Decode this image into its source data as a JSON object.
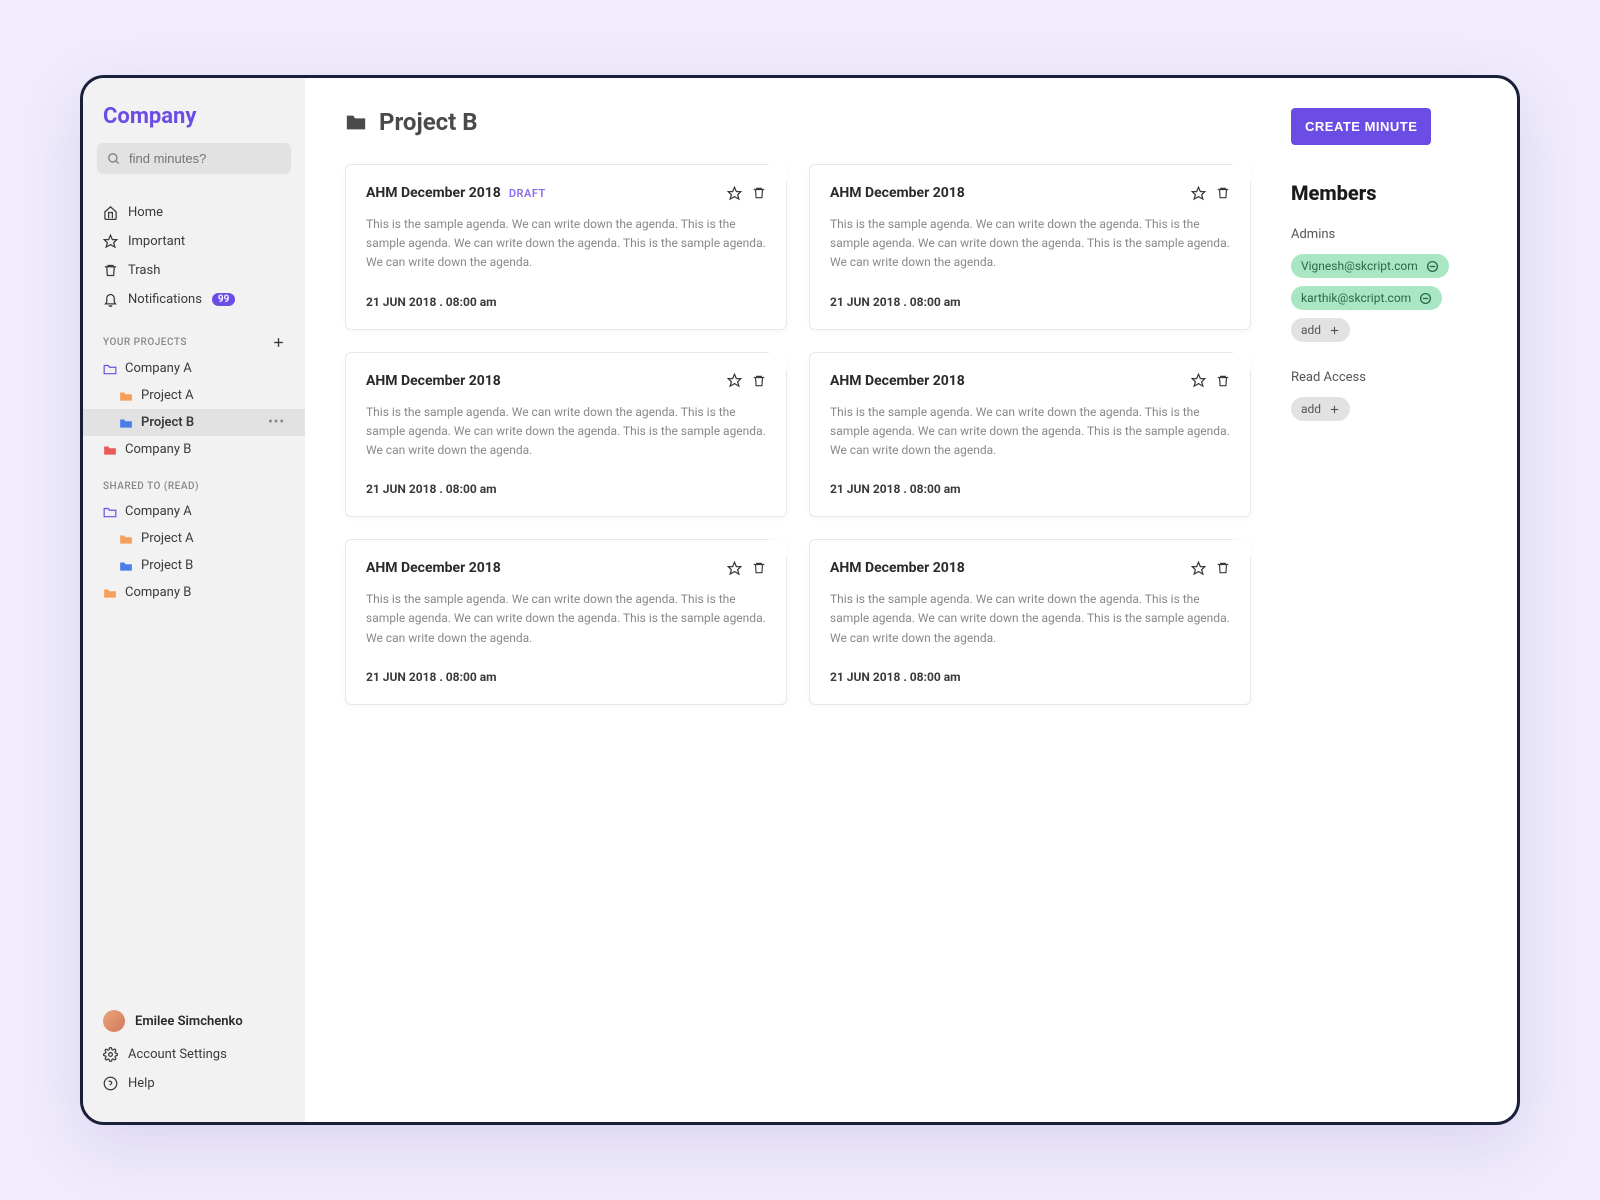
{
  "brand": "Company",
  "search": {
    "placeholder": "find minutes?"
  },
  "nav": {
    "home": "Home",
    "important": "Important",
    "trash": "Trash",
    "notifications": "Notifications",
    "notif_count": "99"
  },
  "sections": {
    "your_projects": "YOUR PROJECTS",
    "shared_read": "SHARED TO (READ)"
  },
  "tree": {
    "company_a": "Company A",
    "project_a": "Project A",
    "project_b": "Project B",
    "company_b": "Company B"
  },
  "user": {
    "name": "Emilee Simchenko",
    "account_settings": "Account Settings",
    "help": "Help"
  },
  "page": {
    "title": "Project B"
  },
  "cards": [
    {
      "title": "AHM December 2018",
      "draft": "DRAFT",
      "desc": "This is the sample agenda. We can write down the agenda. This is the sample agenda. We can write down the agenda. This is the sample agenda. We can write down the agenda.",
      "date": "21 JUN 2018 . 08:00 am"
    },
    {
      "title": "AHM December 2018",
      "draft": "",
      "desc": "This is the sample agenda. We can write down the agenda. This is the sample agenda. We can write down the agenda. This is the sample agenda. We can write down the agenda.",
      "date": "21 JUN 2018 . 08:00 am"
    },
    {
      "title": "AHM December 2018",
      "draft": "",
      "desc": "This is the sample agenda. We can write down the agenda. This is the sample agenda. We can write down the agenda. This is the sample agenda. We can write down the agenda.",
      "date": "21 JUN 2018 . 08:00 am"
    },
    {
      "title": "AHM December 2018",
      "draft": "",
      "desc": "This is the sample agenda. We can write down the agenda. This is the sample agenda. We can write down the agenda. This is the sample agenda. We can write down the agenda.",
      "date": "21 JUN 2018 . 08:00 am"
    },
    {
      "title": "AHM December 2018",
      "draft": "",
      "desc": "This is the sample agenda. We can write down the agenda. This is the sample agenda. We can write down the agenda. This is the sample agenda. We can write down the agenda.",
      "date": "21 JUN 2018 . 08:00 am"
    },
    {
      "title": "AHM December 2018",
      "draft": "",
      "desc": "This is the sample agenda. We can write down the agenda. This is the sample agenda. We can write down the agenda. This is the sample agenda. We can write down the agenda.",
      "date": "21 JUN 2018 . 08:00 am"
    }
  ],
  "right": {
    "create": "CREATE MINUTE",
    "members": "Members",
    "admins": "Admins",
    "admin1": "Vignesh@skcript.com",
    "admin2": "karthik@skcript.com",
    "add": "add",
    "read_access": "Read Access"
  }
}
